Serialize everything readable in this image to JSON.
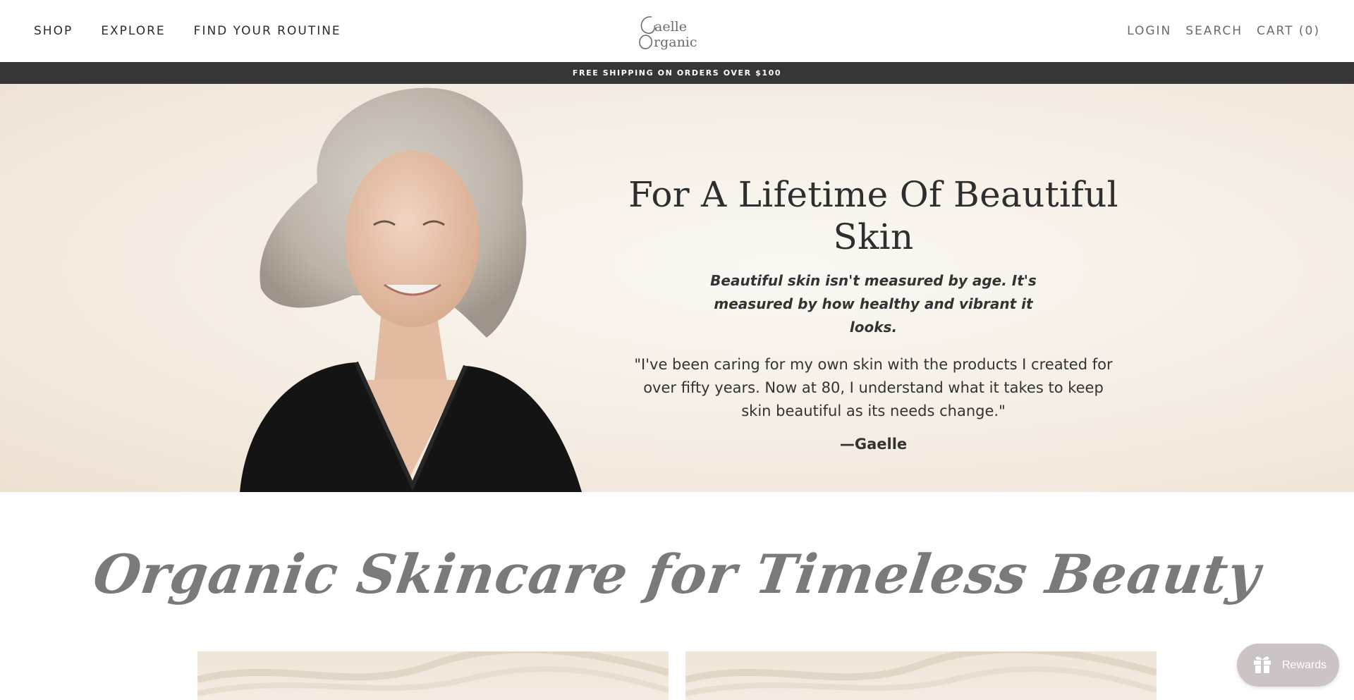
{
  "header": {
    "nav_left": [
      "SHOP",
      "EXPLORE",
      "FIND YOUR ROUTINE"
    ],
    "logo_text": "Gaelle Organic",
    "nav_right": {
      "login": "LOGIN",
      "search": "SEARCH",
      "cart": "CART (0)"
    }
  },
  "announcement": "FREE SHIPPING ON ORDERS OVER $100",
  "hero": {
    "title": "For A Lifetime Of Beautiful Skin",
    "subtitle": "Beautiful skin isn't measured by age. It's measured by how healthy and vibrant it looks.",
    "quote": "\"I've been caring for my own skin with the products I created for over fifty years. Now at 80, I understand what it takes to keep skin beautiful as its needs change.\"",
    "signature": "—Gaelle"
  },
  "section": {
    "title": "Organic Skincare for Timeless Beauty"
  },
  "rewards": {
    "label": "Rewards",
    "icon": "gift-icon"
  },
  "colors": {
    "announcement_bg": "#363636",
    "hero_bg": "#f6efe6",
    "rewards_bg": "#ccc4c4",
    "script_gray": "#7a7a7a"
  }
}
